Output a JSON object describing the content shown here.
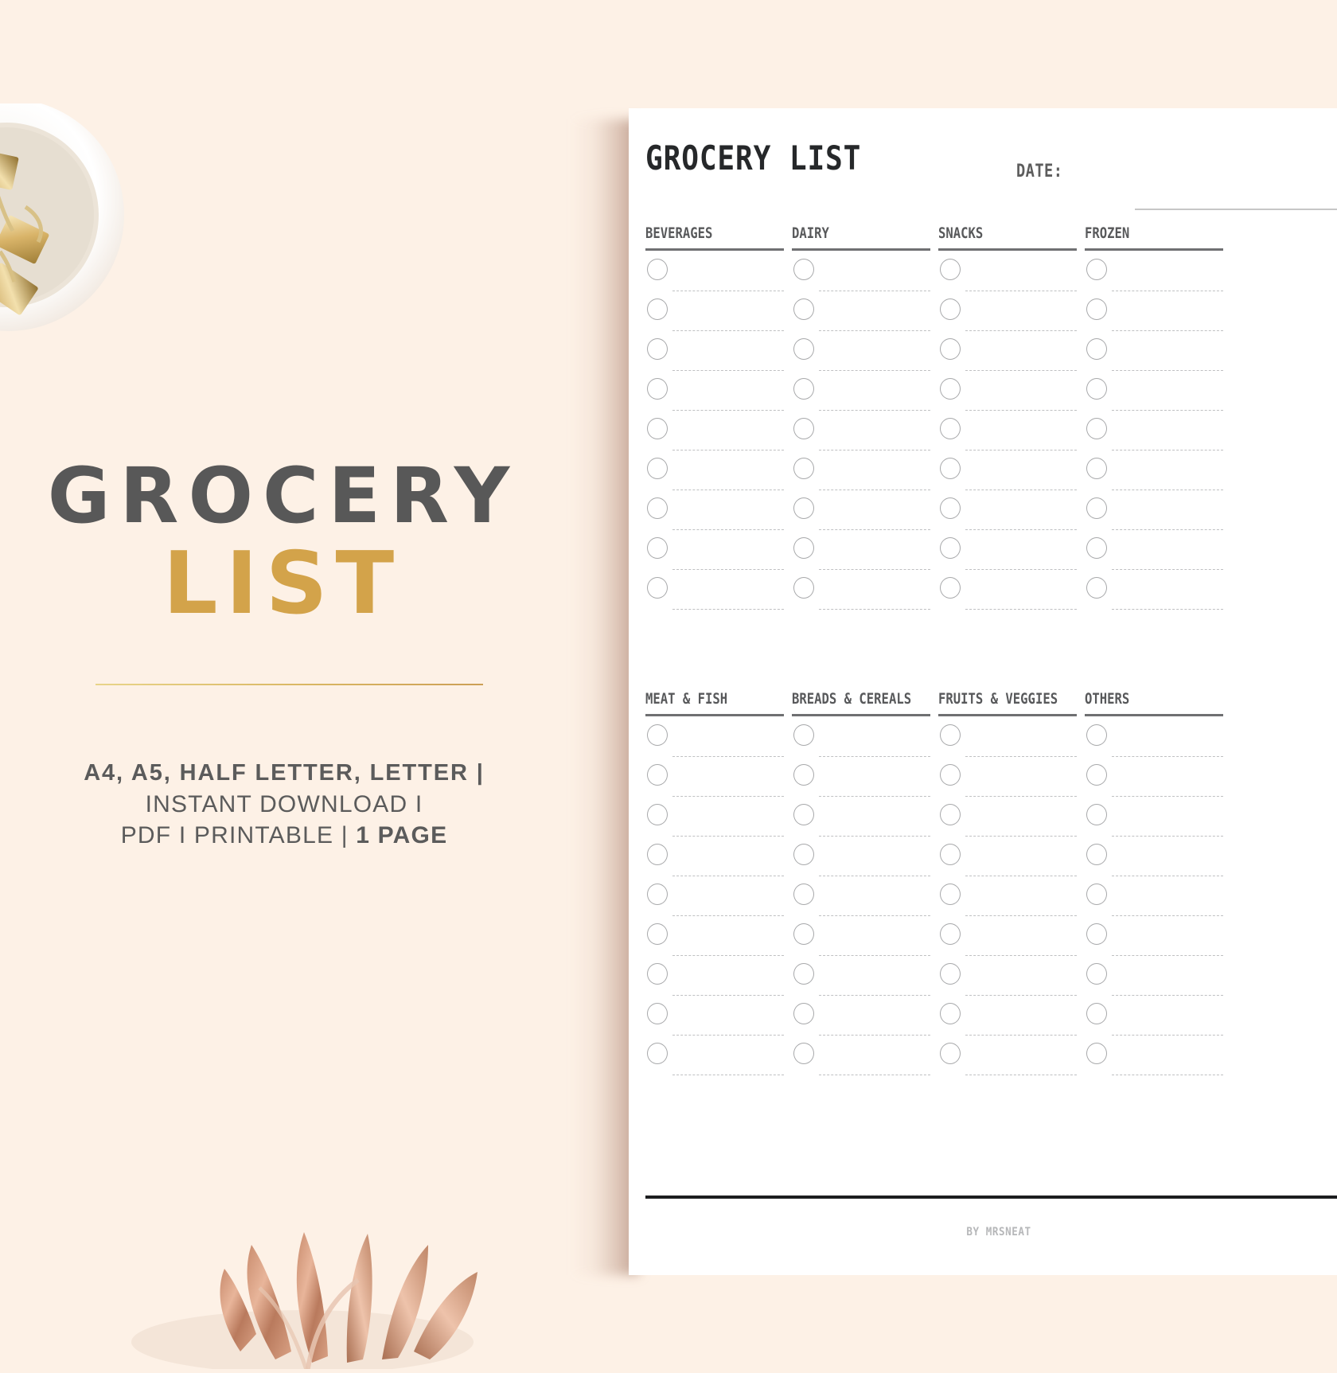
{
  "background": {
    "color": "#fdf1e6"
  },
  "promo": {
    "title_line_1": "GROCERY",
    "title_line_2": "LIST",
    "title_color_1": "#585858",
    "title_color_2": "#d3a34a",
    "divider_color": "#d9b662",
    "sub_line_1": "A4, A5, HALF LETTER, LETTER |",
    "sub_line_2": "INSTANT DOWNLOAD I",
    "sub_line_3_pre": "PDF I PRINTABLE | ",
    "sub_line_3_bold": "1 PAGE"
  },
  "decor": {
    "bowl_name": "bowl-of-gold-binder-clips",
    "leaf_name": "rose-gold-monstera-leaf"
  },
  "sheet": {
    "title": "GROCERY LIST",
    "date_label": "DATE:",
    "credit": "BY MRSNEAT",
    "rows_per_column": 9,
    "sections": [
      {
        "columns": [
          {
            "header": "BEVERAGES"
          },
          {
            "header": "DAIRY"
          },
          {
            "header": "SNACKS"
          },
          {
            "header": "FROZEN"
          }
        ]
      },
      {
        "columns": [
          {
            "header": "MEAT & FISH"
          },
          {
            "header": "BREADS & CEREALS"
          },
          {
            "header": "FRUITS & VEGGIES"
          },
          {
            "header": "OTHERS"
          }
        ]
      }
    ]
  }
}
